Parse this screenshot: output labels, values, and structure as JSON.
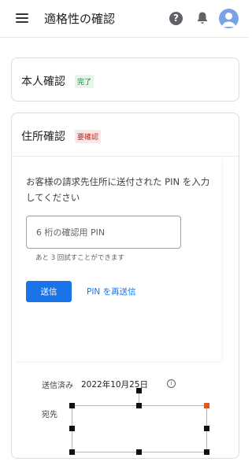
{
  "appbar": {
    "title": "適格性の確認",
    "icons": [
      "menu-icon",
      "help-icon",
      "bell-icon",
      "avatar"
    ]
  },
  "cards": {
    "identity": {
      "title": "本人確認",
      "badge": "完了"
    },
    "address": {
      "title": "住所確認",
      "badge": "要確認",
      "instruction": "お客様の請求先住所に送付された PIN を入力してください",
      "pin_placeholder": "6 桁の確認用 PIN",
      "attempts_note": "あと 3 回試すことができます",
      "send_label": "送信",
      "resend_label": "PIN を再送信",
      "sent_label": "送信済み",
      "sent_date": "2022年10月25日",
      "recipient_label": "宛先"
    }
  },
  "colors": {
    "primary": "#1a73e8",
    "success_bg": "#e6f4ea",
    "success_text": "#188038",
    "warning_bg": "#fce8e6",
    "warning_text": "#c5221f",
    "avatar": "#7aa3e5",
    "handle_accent": "#e8541a"
  }
}
